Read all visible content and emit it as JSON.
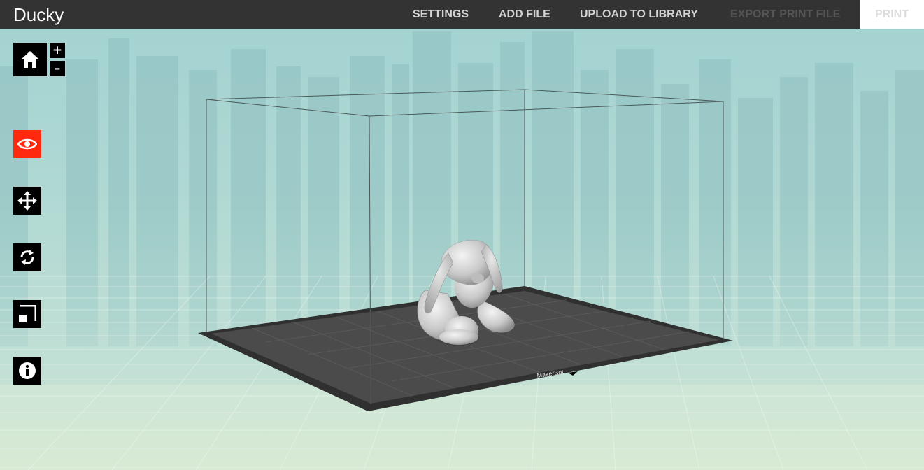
{
  "app": {
    "title": "Ducky"
  },
  "nav": {
    "settings": "SETTINGS",
    "add_file": "ADD FILE",
    "upload_to_library": "UPLOAD TO LIBRARY",
    "export_print_file": "EXPORT PRINT FILE",
    "print": "PRINT"
  },
  "view_controls": {
    "zoom_in": "+",
    "zoom_out": "–"
  },
  "toolbar": {
    "items": [
      {
        "icon": "eye-icon",
        "state": "active"
      },
      {
        "icon": "move-icon",
        "state": "default"
      },
      {
        "icon": "rotate-icon",
        "state": "default"
      },
      {
        "icon": "scale-icon",
        "state": "default"
      },
      {
        "icon": "info-icon",
        "state": "default"
      }
    ]
  },
  "colors": {
    "topbar": "#333333",
    "active_tool": "#ff2a0e",
    "tool_bg": "#000000",
    "platform": "#4a4b4a"
  },
  "build_plate": {
    "brand_label": "MakerBot"
  }
}
